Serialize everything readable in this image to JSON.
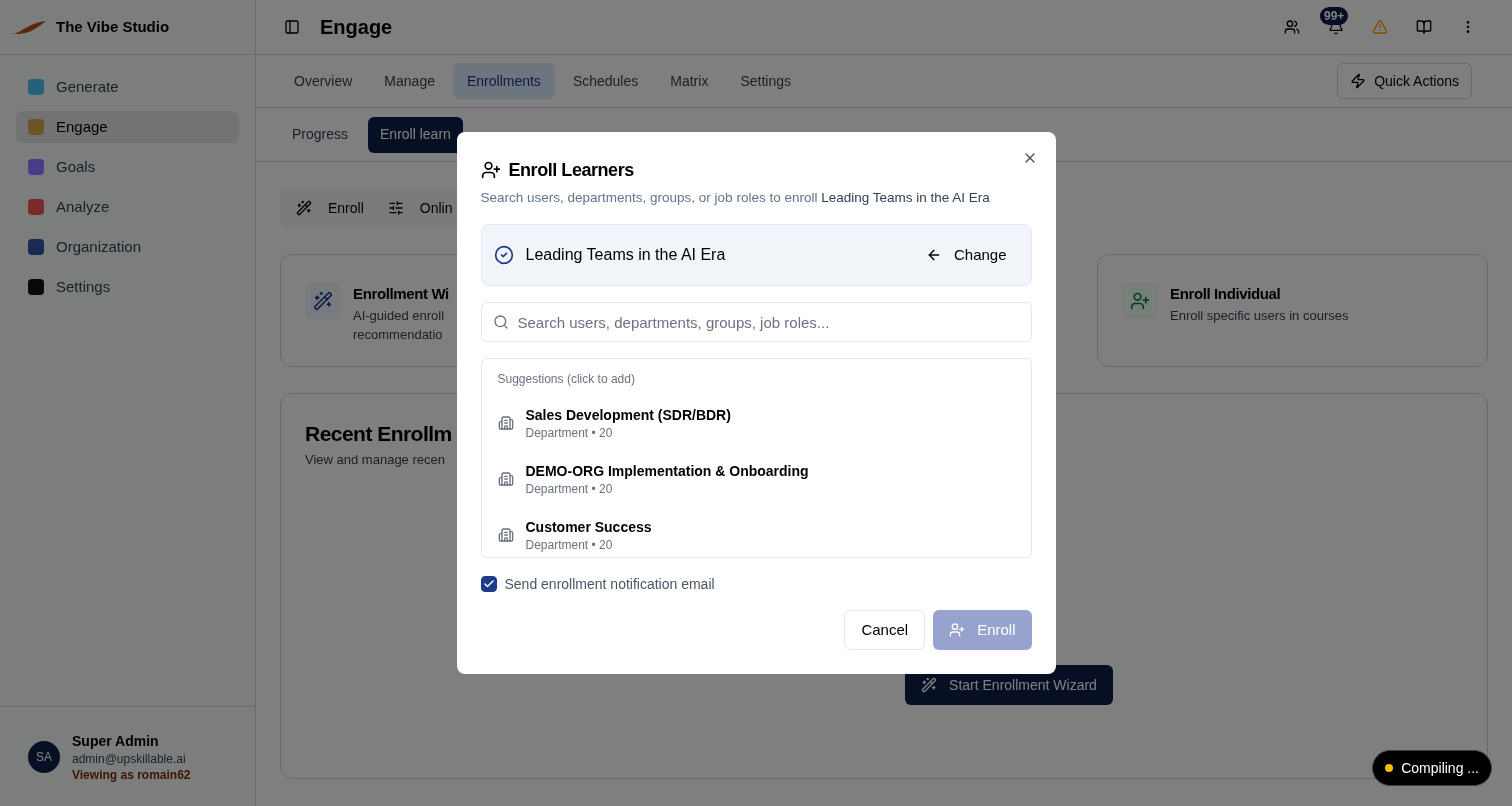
{
  "app": {
    "name": "The Vibe Studio"
  },
  "sidebar": {
    "items": [
      {
        "label": "Generate",
        "color": "#24627a",
        "selected": false
      },
      {
        "label": "Engage",
        "color": "#6b5526",
        "selected": true
      },
      {
        "label": "Goals",
        "color": "#4a3a8a",
        "selected": false
      },
      {
        "label": "Analyze",
        "color": "#7a2a2a",
        "selected": false
      },
      {
        "label": "Organization",
        "color": "#1b2a55",
        "selected": false
      },
      {
        "label": "Settings",
        "color": "#0a0a0a",
        "selected": false
      }
    ],
    "user": {
      "initials": "SA",
      "name": "Super Admin",
      "email": "admin@upskillable.ai",
      "viewing_as": "Viewing as romain62"
    }
  },
  "header": {
    "title": "Engage",
    "notification_badge": "99+"
  },
  "tabs": [
    {
      "label": "Overview",
      "selected": false
    },
    {
      "label": "Manage",
      "selected": false
    },
    {
      "label": "Enrollments",
      "selected": true
    },
    {
      "label": "Schedules",
      "selected": false
    },
    {
      "label": "Matrix",
      "selected": false
    },
    {
      "label": "Settings",
      "selected": false
    }
  ],
  "quick_actions": "Quick Actions",
  "subtabs": [
    {
      "label": "Progress",
      "selected": false
    },
    {
      "label": "Enroll learn",
      "selected": true
    }
  ],
  "toolbar": [
    {
      "kind": "wand",
      "label": "Enroll"
    },
    {
      "kind": "sliders",
      "label": "Onlin"
    }
  ],
  "cards": [
    {
      "kind": "wand",
      "title": "Enrollment Wi",
      "lines": [
        "AI-guided enroll",
        "recommendatio"
      ]
    },
    {
      "kind": "user",
      "title": "Enroll Individual",
      "lines": [
        "Enroll specific users in courses"
      ]
    }
  ],
  "recent": {
    "title": "Recent Enrollm",
    "subtitle": "View and manage recen",
    "button": "Start Enrollment Wizard"
  },
  "dialog": {
    "title": "Enroll Learners",
    "description": "Search users, departments, groups, or job roles to enroll **Leading Teams in the AI Era**",
    "course": "Leading Teams in the AI Era",
    "change": "Change",
    "search": {
      "placeholder": "Search users, departments, groups, job roles..."
    },
    "suggestions_label": "Suggestions (click to add)",
    "suggestions": [
      {
        "name": "Sales Development (SDR/BDR)",
        "meta": "Department • 20"
      },
      {
        "name": "DEMO-ORG Implementation & Onboarding",
        "meta": "Department • 20"
      },
      {
        "name": "Customer Success",
        "meta": "Department • 20"
      }
    ],
    "notify": {
      "label": "Send enrollment notification email",
      "checked": true
    },
    "cancel": "Cancel",
    "enroll": {
      "label": "Enroll",
      "disabled": true
    }
  },
  "status": {
    "text": "Compiling ..."
  }
}
